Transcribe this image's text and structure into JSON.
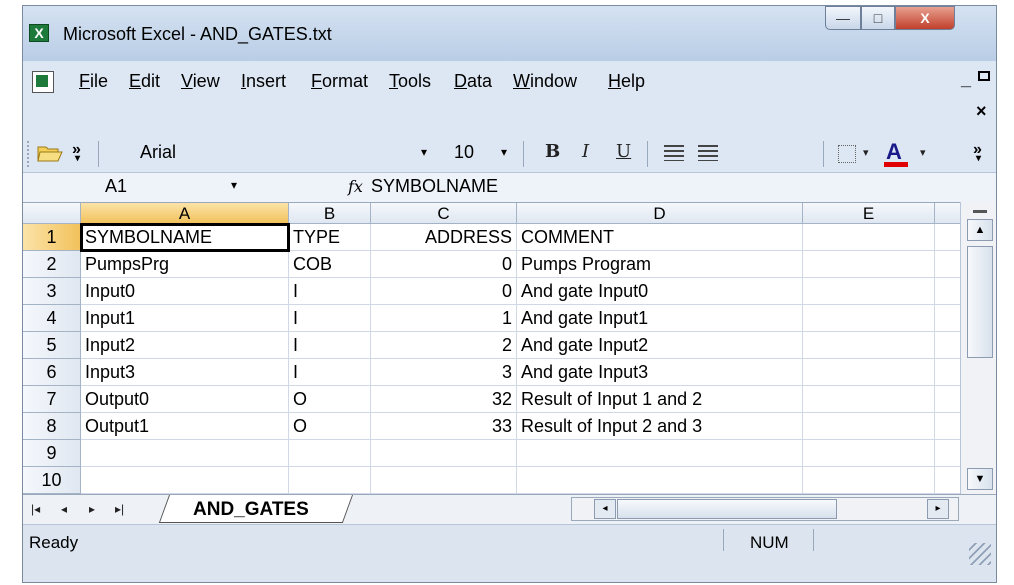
{
  "window": {
    "title": "Microsoft Excel - AND_GATES.txt",
    "app_icon_glyph": "X",
    "controls": {
      "minimize": "—",
      "maximize": "□",
      "close": "X"
    }
  },
  "menu": {
    "items": [
      "File",
      "Edit",
      "View",
      "Insert",
      "Format",
      "Tools",
      "Data",
      "Window",
      "Help"
    ],
    "mdi": {
      "minimize": "_",
      "close": "×"
    }
  },
  "toolbar": {
    "font_name": "Arial",
    "font_size": "10",
    "bold": "B",
    "italic": "I",
    "underline": "U",
    "font_color_glyph": "A",
    "font_color": "#e00000",
    "overflow": "»",
    "dropdown": "▾"
  },
  "formula_bar": {
    "name_box": "A1",
    "fx": "fx",
    "formula": "SYMBOLNAME"
  },
  "sheet": {
    "columns": [
      "A",
      "B",
      "C",
      "D",
      "E"
    ],
    "rows": [
      {
        "num": "1",
        "cells": [
          "SYMBOLNAME",
          "TYPE",
          "ADDRESS",
          "COMMENT",
          ""
        ]
      },
      {
        "num": "2",
        "cells": [
          "PumpsPrg",
          "COB",
          "0",
          "Pumps Program",
          ""
        ]
      },
      {
        "num": "3",
        "cells": [
          "Input0",
          "I",
          "0",
          "And gate Input0",
          ""
        ]
      },
      {
        "num": "4",
        "cells": [
          "Input1",
          "I",
          "1",
          "And gate Input1",
          ""
        ]
      },
      {
        "num": "5",
        "cells": [
          "Input2",
          "I",
          "2",
          "And gate Input2",
          ""
        ]
      },
      {
        "num": "6",
        "cells": [
          "Input3",
          "I",
          "3",
          "And gate Input3",
          ""
        ]
      },
      {
        "num": "7",
        "cells": [
          "Output0",
          "O",
          "32",
          "Result of Input 1 and 2",
          ""
        ]
      },
      {
        "num": "8",
        "cells": [
          "Output1",
          "O",
          "33",
          "Result of Input 2 and 3",
          ""
        ]
      },
      {
        "num": "9",
        "cells": [
          "",
          "",
          "",
          "",
          ""
        ]
      },
      {
        "num": "10",
        "cells": [
          "",
          "",
          "",
          "",
          ""
        ]
      }
    ],
    "active_cell": "A1"
  },
  "tabs": {
    "nav": [
      "|◂",
      "◂",
      "▸",
      "▸|"
    ],
    "sheets": [
      "AND_GATES"
    ]
  },
  "scroll": {
    "up": "▲",
    "down": "▼",
    "left": "◂",
    "right": "▸"
  },
  "status": {
    "left": "Ready",
    "num_lock": "NUM"
  }
}
